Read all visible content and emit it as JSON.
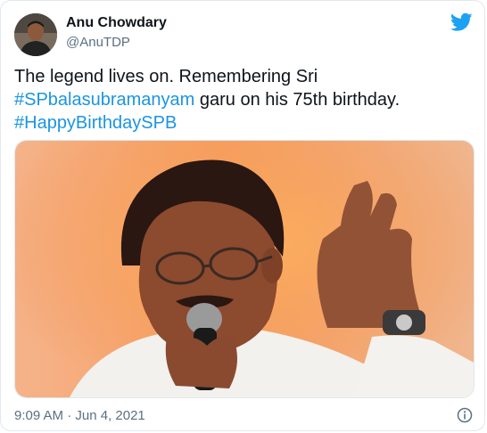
{
  "author": {
    "name": "Anu Chowdary",
    "handle": "@AnuTDP"
  },
  "tweet": {
    "line1": "The legend lives on. Remembering Sri",
    "hashtag1": "#SPbalasubramanyam",
    "line2_rest": " garu on his 75th birthday.",
    "hashtag2": "#HappyBirthdaySPB"
  },
  "timestamp": "9:09 AM · Jun 4, 2021",
  "colors": {
    "link": "#1b95e0",
    "twitter_blue": "#1da1f2",
    "muted": "#5b7083"
  },
  "icons": {
    "brand": "twitter-bird-icon",
    "info": "info-icon"
  }
}
